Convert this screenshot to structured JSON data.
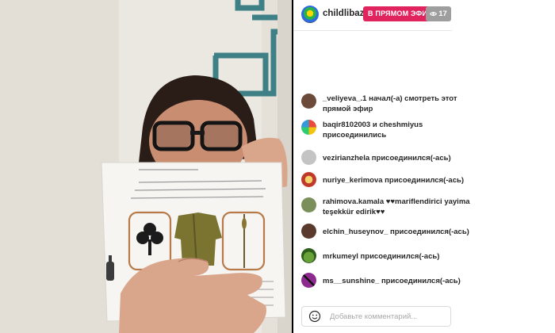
{
  "header": {
    "username": "childlibaze...",
    "live_label": "В ПРЯМОМ ЭФИРЕ",
    "viewers_count": "17",
    "eye_icon": "eye-icon"
  },
  "feed": [
    {
      "user": "_veliyeva_.1",
      "text": "начал(-а) смотреть этот прямой эфир",
      "avatar_color": "#6b4a3a"
    },
    {
      "user": "baqir8102003",
      "text": "и cheshmiyus присоединились",
      "avatar_color": "#c0392b"
    },
    {
      "user": "vezirianzhela",
      "text": "присоединился(-ась)",
      "avatar_color": "#bdbdbd"
    },
    {
      "user": "nuriye_kerimova",
      "text": "присоединился(-ась)",
      "avatar_color": "#d0463a"
    },
    {
      "user": "rahimova.kamala",
      "text": "♥♥mariflendirici yayima teşekkür edirik♥♥",
      "avatar_color": "#7a8f5a"
    },
    {
      "user": "elchin_huseynov_",
      "text": "присоединился(-ась)",
      "avatar_color": "#5b3a2e"
    },
    {
      "user": "mrkumeyl",
      "text": "присоединился(-ась)",
      "avatar_color": "#4a7a2c"
    },
    {
      "user": "ms__sunshine_",
      "text": "присоединился(-ась)",
      "avatar_color": "#8e2a8f"
    }
  ],
  "comment": {
    "placeholder": "Добавьте комментарий...",
    "emoji_icon": "smiley-icon"
  }
}
